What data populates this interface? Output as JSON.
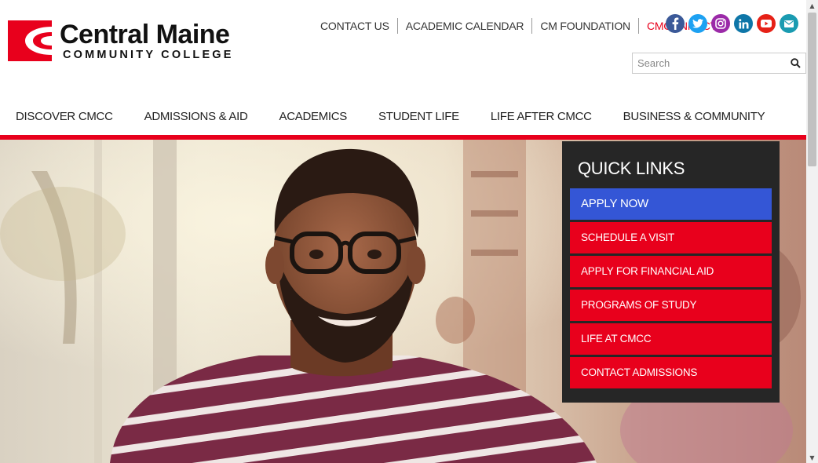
{
  "logo": {
    "main": "Central Maine",
    "sub": "COMMUNITY COLLEGE",
    "brand_color": "#e8001c"
  },
  "top_links": [
    "CONTACT US",
    "ACADEMIC CALENDAR",
    "CM FOUNDATION",
    "CMCONNECT"
  ],
  "social": [
    {
      "icon": "facebook-icon",
      "glyph": "f",
      "color": "#3b5998"
    },
    {
      "icon": "twitter-icon",
      "glyph": "t",
      "color": "#1da1f2"
    },
    {
      "icon": "instagram-icon",
      "glyph": "◎",
      "color": "#9b2aa8"
    },
    {
      "icon": "linkedin-icon",
      "glyph": "in",
      "color": "#0e76a8"
    },
    {
      "icon": "youtube-icon",
      "glyph": "▶",
      "color": "#e62117"
    },
    {
      "icon": "email-icon",
      "glyph": "✉",
      "color": "#1a9bb1"
    }
  ],
  "search": {
    "placeholder": "Search",
    "value": ""
  },
  "nav": [
    "DISCOVER CMCC",
    "ADMISSIONS & AID",
    "ACADEMICS",
    "STUDENT LIFE",
    "LIFE AFTER CMCC",
    "BUSINESS & COMMUNITY"
  ],
  "quick_links": {
    "title": "QUICK LINKS",
    "items": [
      "APPLY NOW",
      "SCHEDULE A VISIT",
      "APPLY FOR FINANCIAL AID",
      "PROGRAMS OF STUDY",
      "LIFE AT CMCC",
      "CONTACT ADMISSIONS"
    ],
    "apply_color": "#3456d6",
    "item_color": "#e8001c"
  }
}
